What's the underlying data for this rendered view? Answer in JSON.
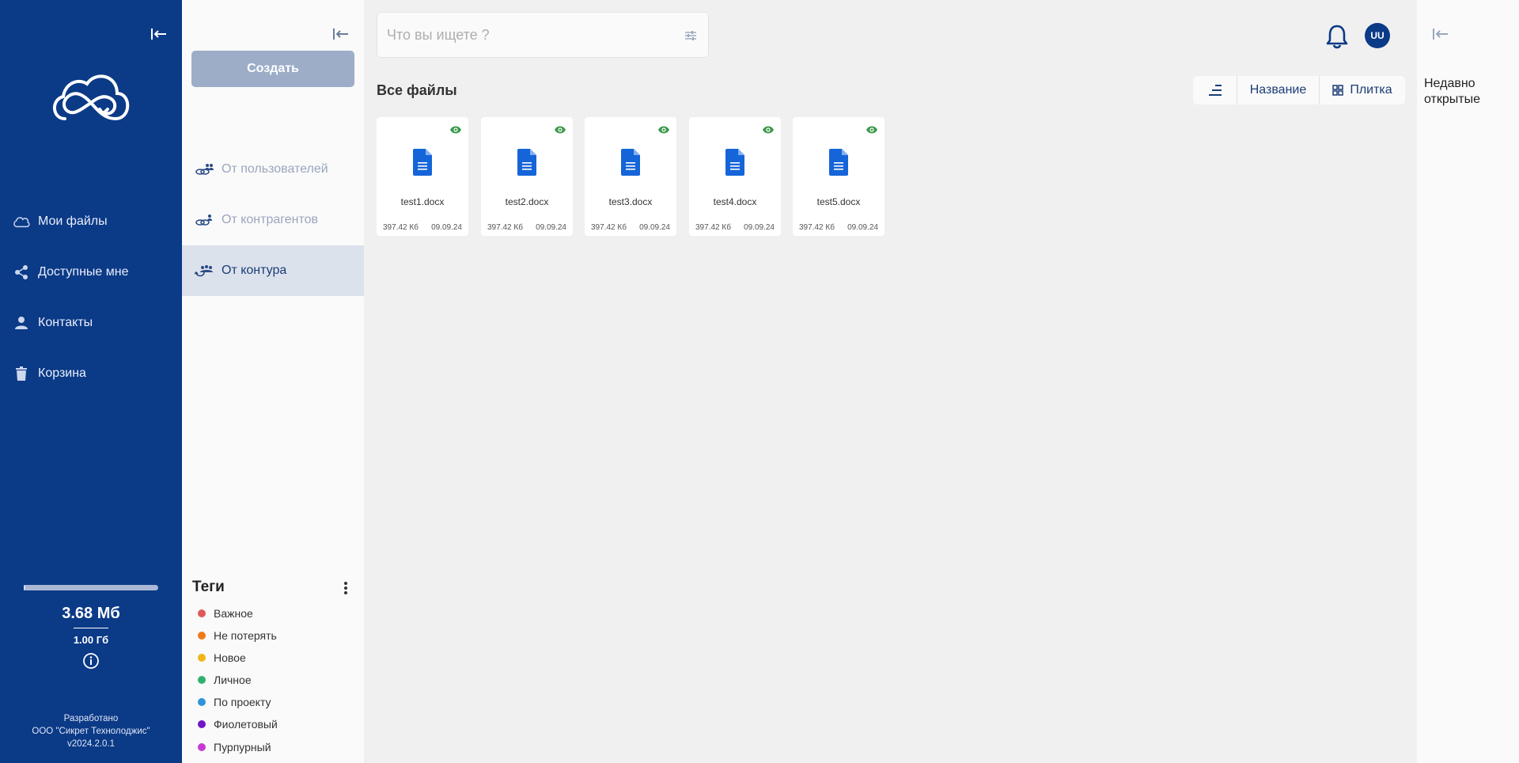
{
  "sidebar": {
    "items": [
      {
        "label": "Мои файлы",
        "icon": "cloud-icon"
      },
      {
        "label": "Доступные мне",
        "icon": "share-icon"
      },
      {
        "label": "Контакты",
        "icon": "person-icon"
      },
      {
        "label": "Корзина",
        "icon": "trash-icon"
      }
    ],
    "storage": {
      "used": "3.68 Мб",
      "total": "1.00 Гб",
      "used_fraction": 0.004
    },
    "footer": {
      "line1": "Разработано",
      "line2": "ООО \"Сикрет Технолоджис\"",
      "version": "v2024.2.0.1"
    }
  },
  "panel": {
    "create_label": "Создать",
    "sources": [
      {
        "label": "От пользователей",
        "active": false
      },
      {
        "label": "От контрагентов",
        "active": false
      },
      {
        "label": "От контура",
        "active": true
      }
    ],
    "tags_title": "Теги",
    "tags": [
      {
        "label": "Важное",
        "color": "#e05a5a"
      },
      {
        "label": "Не потерять",
        "color": "#f07a16"
      },
      {
        "label": "Новое",
        "color": "#f2b416"
      },
      {
        "label": "Личное",
        "color": "#2fb36b"
      },
      {
        "label": "По проекту",
        "color": "#2f95d8"
      },
      {
        "label": "Фиолетовый",
        "color": "#7016c8"
      },
      {
        "label": "Пурпурный",
        "color": "#c83ad8"
      }
    ]
  },
  "main": {
    "search_placeholder": "Что вы ищете ?",
    "avatar_initials": "UU",
    "heading": "Все файлы",
    "sort_label": "Название",
    "view_label": "Плитка",
    "files": [
      {
        "name": "test1.docx",
        "size": "397.42 Кб",
        "date": "09.09.24"
      },
      {
        "name": "test2.docx",
        "size": "397.42 Кб",
        "date": "09.09.24"
      },
      {
        "name": "test3.docx",
        "size": "397.42 Кб",
        "date": "09.09.24"
      },
      {
        "name": "test4.docx",
        "size": "397.42 Кб",
        "date": "09.09.24"
      },
      {
        "name": "test5.docx",
        "size": "397.42 Кб",
        "date": "09.09.24"
      }
    ]
  },
  "right_panel": {
    "title": "Недавно открытые"
  },
  "colors": {
    "brand": "#0b3a87",
    "doc_icon": "#1565d8",
    "eye": "#3d9a4e"
  }
}
